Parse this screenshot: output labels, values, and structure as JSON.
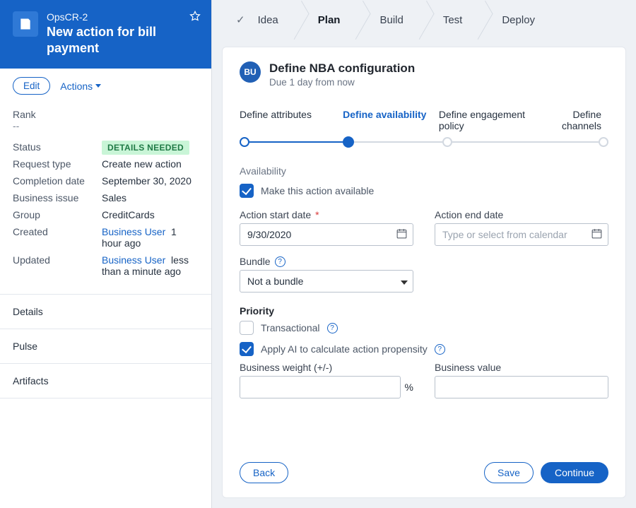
{
  "hero": {
    "id": "OpsCR-2",
    "title": "New action for bill payment"
  },
  "toolbar": {
    "edit": "Edit",
    "actions": "Actions"
  },
  "kv": {
    "rank_label": "Rank",
    "rank_value": "--",
    "status_label": "Status",
    "status_badge": "DETAILS NEEDED",
    "request_type_label": "Request type",
    "request_type_value": "Create new action",
    "completion_label": "Completion date",
    "completion_value": "September 30, 2020",
    "issue_label": "Business issue",
    "issue_value": "Sales",
    "group_label": "Group",
    "group_value": "CreditCards",
    "created_label": "Created",
    "created_user": "Business User",
    "created_time": "1 hour ago",
    "updated_label": "Updated",
    "updated_user": "Business User",
    "updated_time": "less than a minute ago"
  },
  "nav": {
    "details": "Details",
    "pulse": "Pulse",
    "artifacts": "Artifacts"
  },
  "stages": {
    "idea": "Idea",
    "plan": "Plan",
    "build": "Build",
    "test": "Test",
    "deploy": "Deploy"
  },
  "panel": {
    "avatar_initials": "BU",
    "title": "Define NBA configuration",
    "due": "Due 1 day from now"
  },
  "steps": {
    "s1": "Define attributes",
    "s2": "Define availability",
    "s3": "Define engagement policy",
    "s4": "Define channels"
  },
  "form": {
    "availability_label": "Availability",
    "make_available": "Make this action available",
    "start_label": "Action start date",
    "start_value": "9/30/2020",
    "end_label": "Action end date",
    "end_placeholder": "Type or select from calendar",
    "bundle_label": "Bundle",
    "bundle_value": "Not a bundle",
    "priority_header": "Priority",
    "transactional": "Transactional",
    "apply_ai": "Apply AI to calculate action propensity",
    "weight_label": "Business weight (+/-)",
    "value_label": "Business value",
    "pct": "%"
  },
  "actions": {
    "back": "Back",
    "save": "Save",
    "continue": "Continue"
  }
}
